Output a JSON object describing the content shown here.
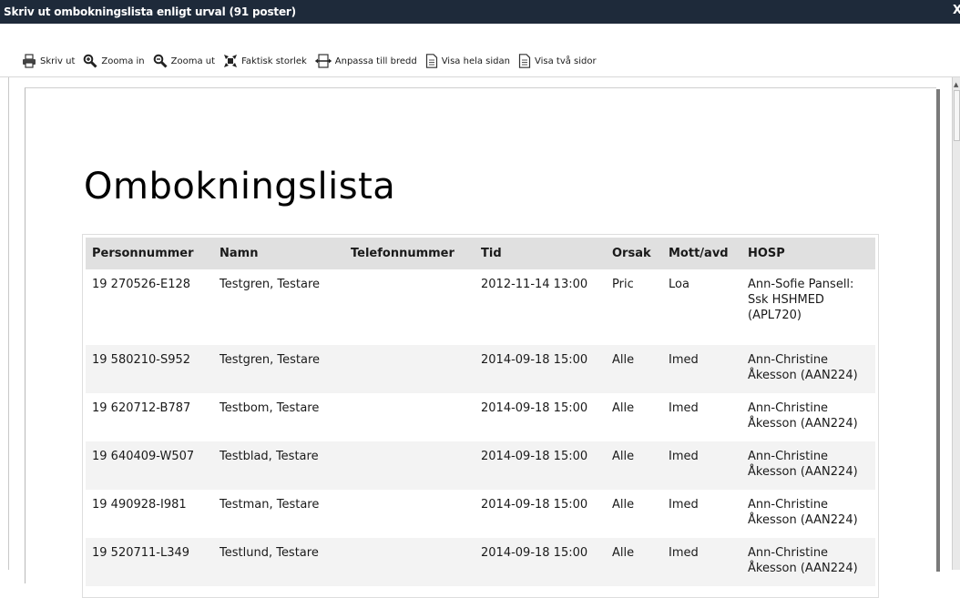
{
  "window": {
    "title": "Skriv ut ombokningslista enligt urval (91 poster)",
    "close_label": "X"
  },
  "toolbar": {
    "buttons": [
      {
        "label": "Skriv ut",
        "icon": "printer-icon"
      },
      {
        "label": "Zooma in",
        "icon": "zoom-in-icon"
      },
      {
        "label": "Zooma ut",
        "icon": "zoom-out-icon"
      },
      {
        "label": "Faktisk storlek",
        "icon": "actual-size-icon"
      },
      {
        "label": "Anpassa till bredd",
        "icon": "fit-width-icon"
      },
      {
        "label": "Visa hela sidan",
        "icon": "page-icon"
      },
      {
        "label": "Visa två sidor",
        "icon": "two-pages-icon"
      }
    ]
  },
  "document": {
    "title": "Ombokningslista",
    "columns": [
      "Personnummer",
      "Namn",
      "Telefonnummer",
      "Tid",
      "Orsak",
      "Mott/avd",
      "HOSP"
    ],
    "rows": [
      {
        "personnummer": "19 270526-E128",
        "namn": "Testgren, Testare",
        "telefon": "",
        "tid": "2012-11-14 13:00",
        "orsak": "Pric",
        "mott": "Loa",
        "hosp": [
          "Ann-Sofie Pansell:",
          "Ssk HSHMED",
          "(APL720)"
        ]
      },
      {
        "personnummer": "19 580210-S952",
        "namn": "Testgren, Testare",
        "telefon": "",
        "tid": "2014-09-18 15:00",
        "orsak": "Alle",
        "mott": "Imed",
        "hosp": [
          "Ann-Christine",
          "Åkesson (AAN224)"
        ]
      },
      {
        "personnummer": "19 620712-B787",
        "namn": "Testbom, Testare",
        "telefon": "",
        "tid": "2014-09-18 15:00",
        "orsak": "Alle",
        "mott": "Imed",
        "hosp": [
          "Ann-Christine",
          "Åkesson (AAN224)"
        ]
      },
      {
        "personnummer": "19 640409-W507",
        "namn": "Testblad, Testare",
        "telefon": "",
        "tid": "2014-09-18 15:00",
        "orsak": "Alle",
        "mott": "Imed",
        "hosp": [
          "Ann-Christine",
          "Åkesson (AAN224)"
        ]
      },
      {
        "personnummer": "19 490928-I981",
        "namn": "Testman, Testare",
        "telefon": "",
        "tid": "2014-09-18 15:00",
        "orsak": "Alle",
        "mott": "Imed",
        "hosp": [
          "Ann-Christine",
          "Åkesson (AAN224)"
        ]
      },
      {
        "personnummer": "19 520711-L349",
        "namn": "Testlund, Testare",
        "telefon": "",
        "tid": "2014-09-18 15:00",
        "orsak": "Alle",
        "mott": "Imed",
        "hosp": [
          "Ann-Christine",
          "Åkesson (AAN224)"
        ]
      }
    ]
  },
  "colors": {
    "titlebar_bg": "#1e2a3a",
    "header_bg": "#e0e0e0",
    "stripe_bg": "#f3f3f3"
  }
}
